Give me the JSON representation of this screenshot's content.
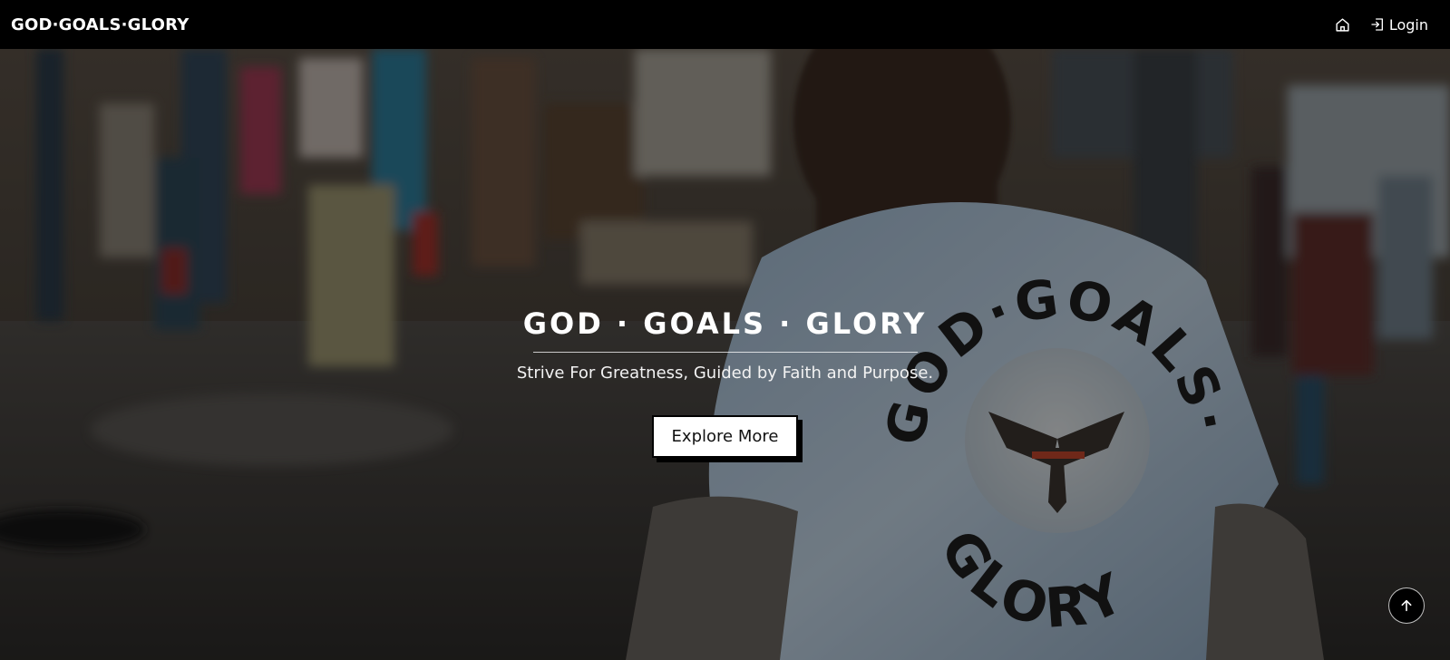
{
  "navbar": {
    "brand": "GOD·GOALS·GLORY",
    "home_icon": "home-icon",
    "login_icon": "login-icon",
    "login_label": "Login"
  },
  "hero": {
    "title": "GOD · GOALS · GLORY",
    "subtitle": "Strive For Greatness, Guided by Faith and Purpose.",
    "cta_label": "Explore More",
    "background": "street-scene-person-wearing-god-goals-glory-tshirt",
    "shirt_print": {
      "top_text": "GOD·GOALS·",
      "bottom_text": "GLORY"
    }
  },
  "scroll_top": {
    "icon": "arrow-up-icon"
  },
  "colors": {
    "navbar_bg": "#000000",
    "text": "#ffffff",
    "button_bg": "#ffffff",
    "button_text": "#111111"
  }
}
